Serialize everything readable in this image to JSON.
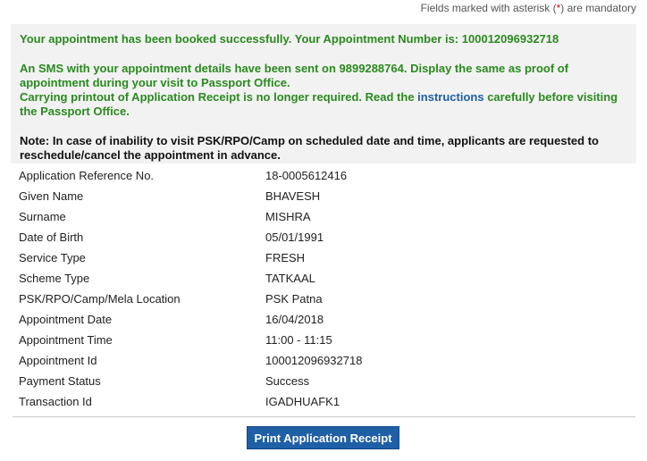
{
  "header": {
    "mandatory_prefix": "Fields marked with asterisk (",
    "mandatory_asterisk": "*",
    "mandatory_suffix": ") are mandatory"
  },
  "message": {
    "booked": "Your appointment has been booked successfully. Your Appointment Number is: 100012096932718",
    "sms": "An SMS with your appointment details have been sent on 9899288764. Display the same as proof of appointment during your visit to Passport Office.",
    "printout_prefix": "Carrying printout of Application Receipt is no longer required. Read the ",
    "instructions_link": "instructions",
    "printout_suffix": " carefully before visiting the Passport Office.",
    "note": "Note: In case of inability to visit PSK/RPO/Camp on scheduled date and time, applicants are requested to reschedule/cancel the appointment in advance."
  },
  "details": [
    {
      "label": "Application Reference No.",
      "value": "18-0005612416"
    },
    {
      "label": "Given Name",
      "value": "BHAVESH"
    },
    {
      "label": "Surname",
      "value": "MISHRA"
    },
    {
      "label": "Date of Birth",
      "value": "05/01/1991"
    },
    {
      "label": "Service Type",
      "value": "FRESH"
    },
    {
      "label": "Scheme Type",
      "value": "TATKAAL"
    },
    {
      "label": "PSK/RPO/Camp/Mela Location",
      "value": "PSK Patna"
    },
    {
      "label": "Appointment Date",
      "value": "16/04/2018"
    },
    {
      "label": "Appointment Time",
      "value": "11:00 - 11:15"
    },
    {
      "label": "Appointment Id",
      "value": "100012096932718"
    },
    {
      "label": "Payment Status",
      "value": "Success"
    },
    {
      "label": "Transaction Id",
      "value": "IGADHUAFK1"
    }
  ],
  "actions": {
    "print_label": "Print Application Receipt"
  },
  "colors": {
    "success_green": "#2a8a1e",
    "link_blue": "#1f5fa6",
    "button_blue": "#1f5fa6",
    "asterisk_red": "#d9001b",
    "message_bg": "#f2f2f2"
  }
}
